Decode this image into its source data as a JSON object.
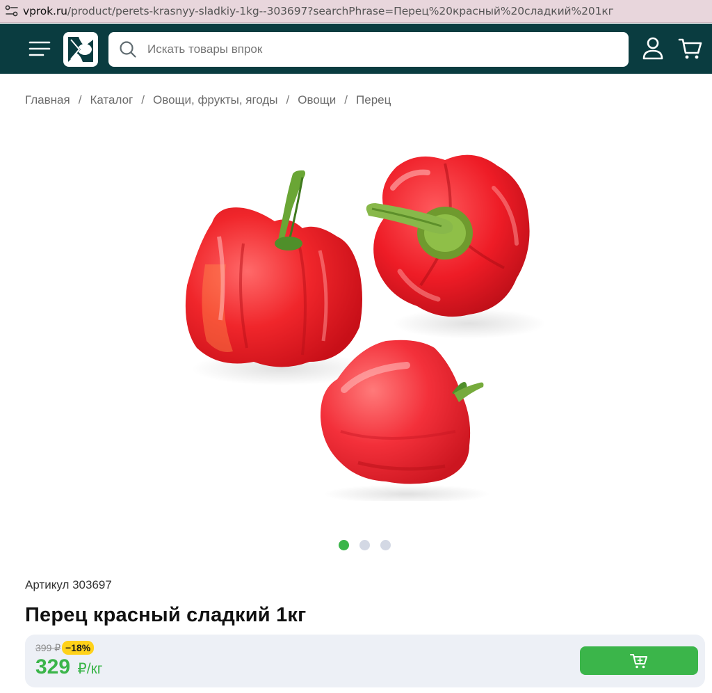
{
  "browser": {
    "url_domain": "vprok.ru",
    "url_path": "/product/perets-krasnyy-sladkiy-1kg--303697?searchPhrase=Перец%20красный%20сладкий%201кг"
  },
  "header": {
    "search_placeholder": "Искать товары впрок",
    "bg_color": "#0a3c40"
  },
  "breadcrumb": [
    "Главная",
    "Каталог",
    "Овощи, фрукты, ягоды",
    "Овощи",
    "Перец"
  ],
  "breadcrumb_separator": "/",
  "gallery": {
    "slide_count": 3,
    "active_index": 0
  },
  "product": {
    "sku": "Артикул 303697",
    "title": "Перец красный сладкий 1кг",
    "old_price": "399 ₽",
    "discount": "−18%",
    "price": "329",
    "unit": "₽/кг"
  },
  "colors": {
    "accent_green": "#3bb54a",
    "badge_yellow": "#ffd21a"
  },
  "icons": [
    "site-settings-icon",
    "menu-icon",
    "logo-icon",
    "search-icon",
    "user-icon",
    "cart-icon",
    "cart-add-icon"
  ]
}
